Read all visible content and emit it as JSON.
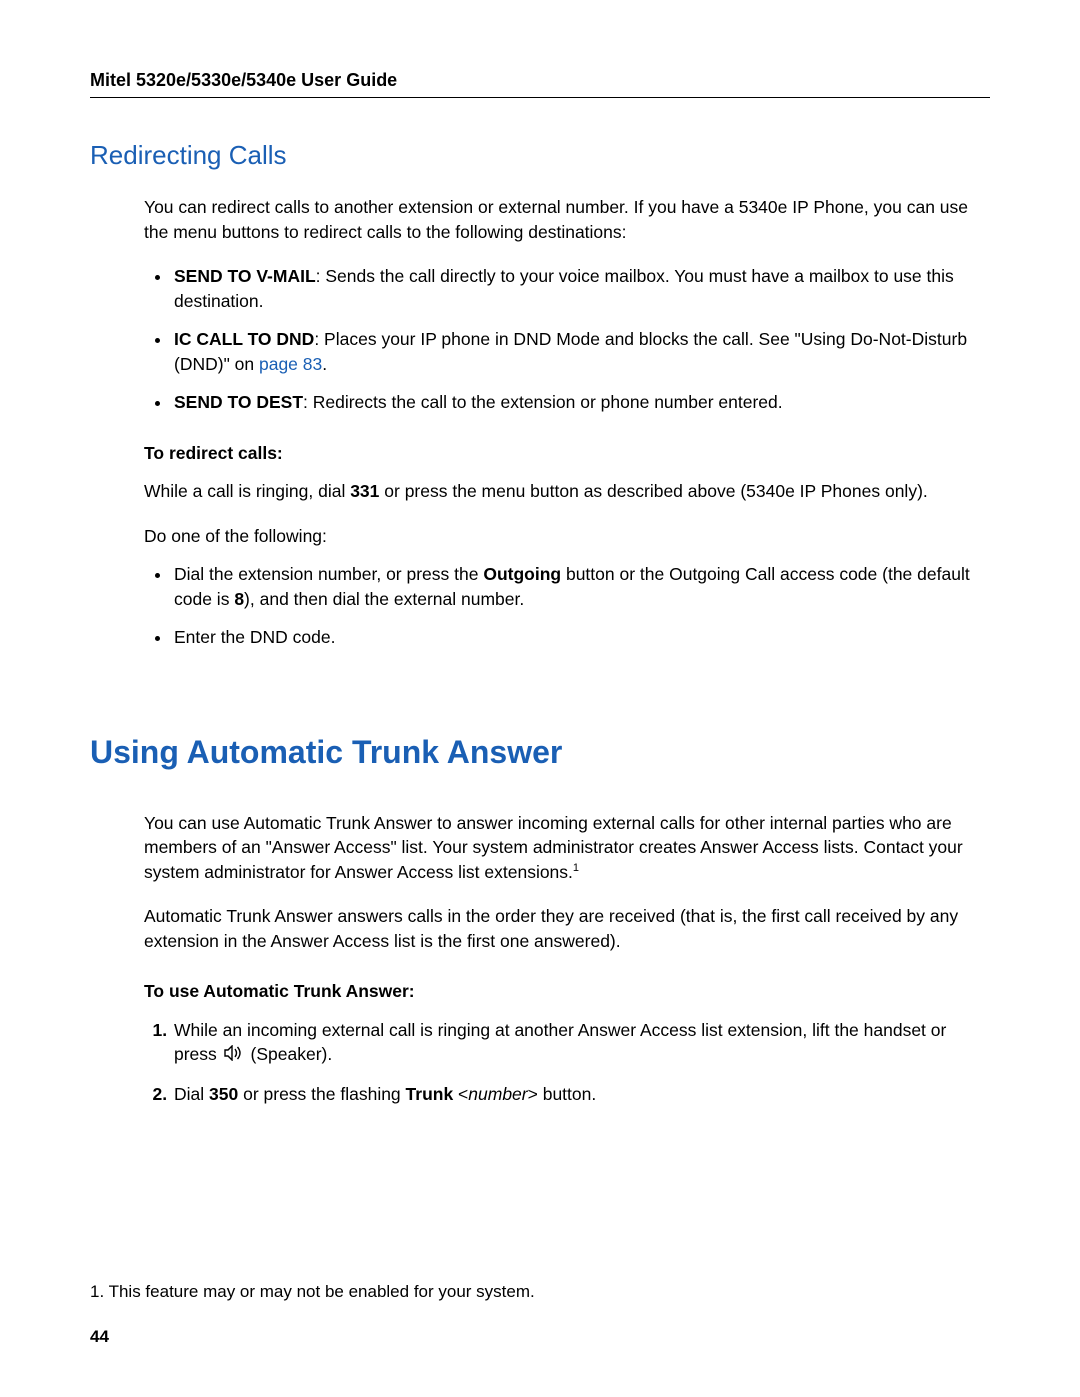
{
  "header": {
    "running_head": "Mitel 5320e/5330e/5340e User Guide"
  },
  "section1": {
    "title": "Redirecting Calls",
    "intro": "You can redirect calls to another extension or external number. If you have a 5340e IP Phone, you can use the menu buttons to redirect calls to the following destinations:",
    "bullets": {
      "b1": {
        "label": "SEND TO V-MAIL",
        "text": ": Sends the call directly to your voice mailbox. You must have a mailbox to use this destination."
      },
      "b2": {
        "label": "IC CALL TO DND",
        "text_a": ": Places your IP phone in DND Mode and blocks the call. See \"Using Do-Not-Disturb (DND)\" on ",
        "link": "page 83",
        "text_b": "."
      },
      "b3": {
        "label": "SEND TO DEST",
        "text": ": Redirects the call to the extension or phone number entered."
      }
    },
    "proc_label": "To redirect calls:",
    "proc_p1_a": "While a call is ringing, dial ",
    "proc_p1_bold": "331",
    "proc_p1_b": " or press the menu button as described above (5340e IP Phones only).",
    "proc_p2": "Do one of the following:",
    "proc_bullets": {
      "pb1_a": "Dial the extension number, or press the ",
      "pb1_bold1": "Outgoing",
      "pb1_b": " button or the Outgoing Call access code (the default code is ",
      "pb1_bold2": "8",
      "pb1_c": "), and then dial the external number.",
      "pb2": "Enter the DND code."
    }
  },
  "section2": {
    "title": "Using Automatic Trunk Answer",
    "p1": "You can use Automatic Trunk Answer to answer incoming external calls for other internal parties who are members of an \"Answer Access\" list. Your system administrator creates Answer Access lists. Contact your system administrator for Answer Access list extensions.",
    "p1_sup": "1",
    "p2": "Automatic Trunk Answer answers calls in the order they are received (that is, the first call received by any extension in the Answer Access list is the first one answered).",
    "proc_label": "To use Automatic Trunk Answer:",
    "steps": {
      "s1_a": "While an incoming external call is ringing at another Answer Access list extension, lift the handset or press ",
      "s1_b": " (Speaker).",
      "s2_a": "Dial ",
      "s2_bold1": "350",
      "s2_b": " or press the flashing ",
      "s2_bold2": "Trunk",
      "s2_c": " <",
      "s2_italic": "number",
      "s2_d": "> button."
    }
  },
  "footnote": {
    "text": "1. This feature may or may not be enabled for your system."
  },
  "page_number": "44"
}
